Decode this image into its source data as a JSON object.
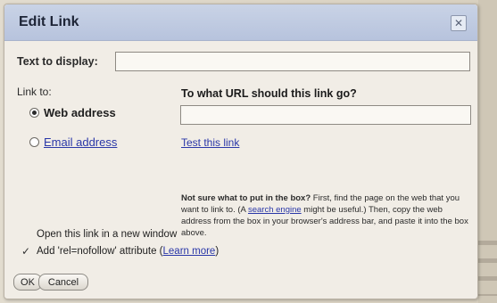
{
  "dialog": {
    "title": "Edit Link",
    "close_icon": "close-icon",
    "text_to_display_label": "Text to display:",
    "text_to_display_value": "",
    "link_to_label": "Link to:",
    "options": [
      {
        "label": "Web address",
        "selected": true
      },
      {
        "label": "Email address",
        "selected": false
      }
    ],
    "url_heading": "To what URL should this link go?",
    "url_value": "",
    "test_link": "Test this link",
    "help": {
      "lead": "Not sure what to put in the box?",
      "part1": " First, find the page on the web that you want to link to. (A ",
      "link": "search engine",
      "part2": " might be useful.) Then, copy the web address from the box in your browser's address bar, and paste it into the box above."
    },
    "open_new_window_label": "Open this link in a new window",
    "open_new_window_checked": false,
    "nofollow_label": "Add 'rel=nofollow' attribute (",
    "learn_more": "Learn more",
    "nofollow_suffix": ")",
    "nofollow_checked": true,
    "ok_label": "OK",
    "cancel_label": "Cancel"
  }
}
